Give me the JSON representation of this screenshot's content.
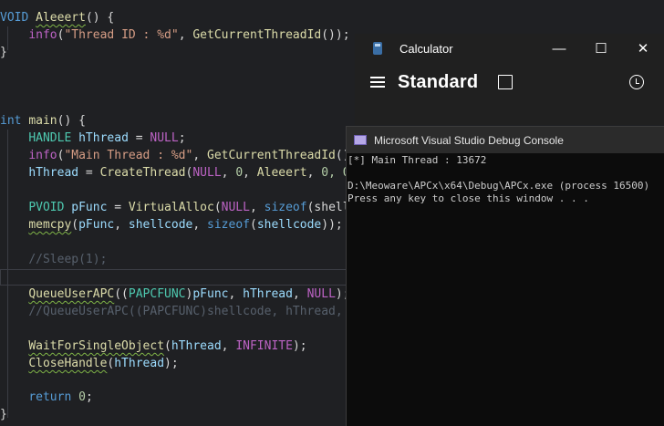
{
  "editor": {
    "lines": [
      [
        {
          "t": "VOID ",
          "c": "kw"
        },
        {
          "t": "Aleeert",
          "c": "fn squig"
        },
        {
          "t": "() {",
          "c": "plain"
        }
      ],
      [
        {
          "t": "    ",
          "c": "plain"
        },
        {
          "t": "info",
          "c": "macro"
        },
        {
          "t": "(",
          "c": "plain"
        },
        {
          "t": "\"Thread ID : %d\"",
          "c": "str"
        },
        {
          "t": ", ",
          "c": "plain"
        },
        {
          "t": "GetCurrentThreadId",
          "c": "fn"
        },
        {
          "t": "());",
          "c": "plain"
        }
      ],
      [
        {
          "t": "}",
          "c": "plain"
        }
      ],
      [
        {
          "t": "int ",
          "c": "kw"
        },
        {
          "t": "main",
          "c": "fn"
        },
        {
          "t": "() {",
          "c": "plain"
        }
      ],
      [
        {
          "t": "    ",
          "c": "plain"
        },
        {
          "t": "HANDLE ",
          "c": "type"
        },
        {
          "t": "hThread",
          "c": "var"
        },
        {
          "t": " = ",
          "c": "plain"
        },
        {
          "t": "NULL",
          "c": "macro"
        },
        {
          "t": ";",
          "c": "plain"
        }
      ],
      [
        {
          "t": "    ",
          "c": "plain"
        },
        {
          "t": "info",
          "c": "macro"
        },
        {
          "t": "(",
          "c": "plain"
        },
        {
          "t": "\"Main Thread : %d\"",
          "c": "str"
        },
        {
          "t": ", ",
          "c": "plain"
        },
        {
          "t": "GetCurrentThreadId",
          "c": "fn"
        },
        {
          "t": "(),",
          "c": "plain"
        }
      ],
      [
        {
          "t": "    ",
          "c": "plain"
        },
        {
          "t": "hThread",
          "c": "var"
        },
        {
          "t": " = ",
          "c": "plain"
        },
        {
          "t": "CreateThread",
          "c": "fn"
        },
        {
          "t": "(",
          "c": "plain"
        },
        {
          "t": "NULL",
          "c": "macro"
        },
        {
          "t": ", ",
          "c": "plain"
        },
        {
          "t": "0",
          "c": "num"
        },
        {
          "t": ", ",
          "c": "plain"
        },
        {
          "t": "Aleeert",
          "c": "fn"
        },
        {
          "t": ", ",
          "c": "plain"
        },
        {
          "t": "0",
          "c": "num"
        },
        {
          "t": ", 0",
          "c": "num"
        }
      ],
      [
        {
          "t": "    ",
          "c": "plain"
        },
        {
          "t": "PVOID ",
          "c": "type"
        },
        {
          "t": "pFunc",
          "c": "var"
        },
        {
          "t": " = ",
          "c": "plain"
        },
        {
          "t": "VirtualAlloc",
          "c": "fn"
        },
        {
          "t": "(",
          "c": "plain"
        },
        {
          "t": "NULL",
          "c": "macro"
        },
        {
          "t": ", ",
          "c": "plain"
        },
        {
          "t": "sizeof",
          "c": "kw"
        },
        {
          "t": "(shell",
          "c": "plain"
        }
      ],
      [
        {
          "t": "    ",
          "c": "plain"
        },
        {
          "t": "memcpy",
          "c": "fn squig"
        },
        {
          "t": "(",
          "c": "plain"
        },
        {
          "t": "pFunc",
          "c": "var"
        },
        {
          "t": ", ",
          "c": "plain"
        },
        {
          "t": "shellcode",
          "c": "var"
        },
        {
          "t": ", ",
          "c": "plain"
        },
        {
          "t": "sizeof",
          "c": "kw"
        },
        {
          "t": "(",
          "c": "plain"
        },
        {
          "t": "shellcode",
          "c": "var"
        },
        {
          "t": "));",
          "c": "plain"
        }
      ],
      [
        {
          "t": "    ",
          "c": "plain"
        },
        {
          "t": "//Sleep(1);",
          "c": "cm"
        }
      ],
      [
        {
          "t": "    ",
          "c": "plain"
        },
        {
          "t": "QueueUserAPC",
          "c": "fn squig"
        },
        {
          "t": "((",
          "c": "plain"
        },
        {
          "t": "PAPCFUNC",
          "c": "type"
        },
        {
          "t": ")",
          "c": "plain"
        },
        {
          "t": "pFunc",
          "c": "var"
        },
        {
          "t": ", ",
          "c": "plain"
        },
        {
          "t": "hThread",
          "c": "var"
        },
        {
          "t": ", ",
          "c": "plain"
        },
        {
          "t": "NULL",
          "c": "macro"
        },
        {
          "t": ");",
          "c": "plain"
        }
      ],
      [
        {
          "t": "    ",
          "c": "plain"
        },
        {
          "t": "//QueueUserAPC((PAPCFUNC)shellcode, hThread,",
          "c": "cm"
        }
      ],
      [
        {
          "t": "    ",
          "c": "plain"
        },
        {
          "t": "WaitForSingleObject",
          "c": "fn squig"
        },
        {
          "t": "(",
          "c": "plain"
        },
        {
          "t": "hThread",
          "c": "var"
        },
        {
          "t": ", ",
          "c": "plain"
        },
        {
          "t": "INFINITE",
          "c": "macro"
        },
        {
          "t": ");",
          "c": "plain"
        }
      ],
      [
        {
          "t": "    ",
          "c": "plain"
        },
        {
          "t": "CloseHandle",
          "c": "fn squig"
        },
        {
          "t": "(",
          "c": "plain"
        },
        {
          "t": "hThread",
          "c": "var"
        },
        {
          "t": ");",
          "c": "plain"
        }
      ],
      [
        {
          "t": "    ",
          "c": "plain"
        },
        {
          "t": "return ",
          "c": "kw"
        },
        {
          "t": "0",
          "c": "num"
        },
        {
          "t": ";",
          "c": "plain"
        }
      ],
      [
        {
          "t": "}",
          "c": "plain"
        }
      ]
    ]
  },
  "calculator": {
    "window_title": "Calculator",
    "mode_title": "Standard",
    "minimize_glyph": "—",
    "maximize_glyph": "☐",
    "close_glyph": "✕",
    "icons": [
      "calculator-app-icon",
      "hamburger-menu-icon",
      "keep-on-top-icon",
      "history-icon"
    ]
  },
  "console": {
    "window_title": "Microsoft Visual Studio Debug Console",
    "output_lines": [
      "[*] Main Thread : 13672",
      "",
      "D:\\Meoware\\APCx\\x64\\Debug\\APCx.exe (process 16500)",
      "Press any key to close this window . . ."
    ]
  }
}
